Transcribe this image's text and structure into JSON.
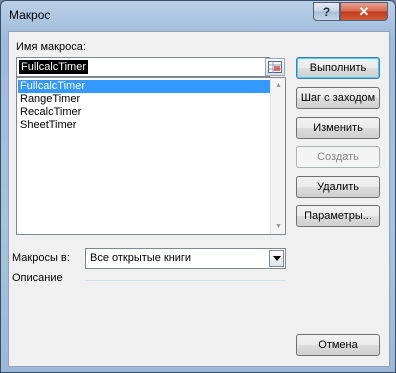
{
  "window": {
    "title": "Макрос",
    "help_label": "?",
    "close_label": "✕"
  },
  "form": {
    "name_label": "Имя макроса:",
    "name_value": "FullcalcTimer",
    "list_items": [
      "FullcalcTimer",
      "RangeTimer",
      "RecalcTimer",
      "SheetTimer"
    ],
    "selected_index": 0,
    "macros_in_label": "Макросы в:",
    "macros_in_value": "Все открытые книги",
    "description_label": "Описание"
  },
  "buttons": {
    "run": "Выполнить",
    "step_into": "Шаг с заходом",
    "edit": "Изменить",
    "create": "Создать",
    "delete": "Удалить",
    "options": "Параметры...",
    "cancel": "Отмена"
  },
  "icons": {
    "ref_button": "range-select-icon",
    "dropdown": "chevron-down-icon",
    "scroll_up": "scroll-up-arrow-icon",
    "scroll_down": "scroll-down-arrow-icon"
  },
  "colors": {
    "selection": "#3399ff",
    "close_button": "#c1391b"
  }
}
